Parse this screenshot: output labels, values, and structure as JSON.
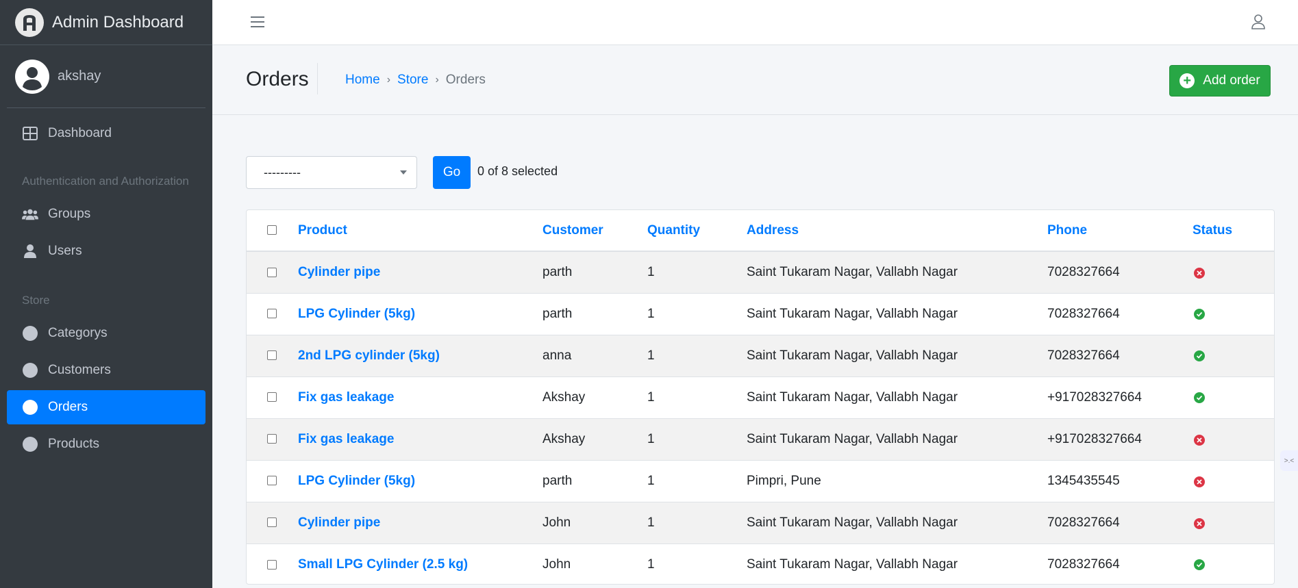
{
  "brand": {
    "title": "Admin Dashboard"
  },
  "user": {
    "name": "akshay"
  },
  "sidebar": {
    "dashboard": "Dashboard",
    "auth_header": "Authentication and Authorization",
    "groups": "Groups",
    "users": "Users",
    "store_header": "Store",
    "categorys": "Categorys",
    "customers": "Customers",
    "orders": "Orders",
    "products": "Products"
  },
  "header": {
    "title": "Orders",
    "breadcrumb": {
      "home": "Home",
      "store": "Store",
      "current": "Orders"
    },
    "add_label": "Add order"
  },
  "actions": {
    "selected_option": "---------",
    "go_label": "Go",
    "selected_count": "0 of 8 selected"
  },
  "table": {
    "columns": {
      "product": "Product",
      "customer": "Customer",
      "quantity": "Quantity",
      "address": "Address",
      "phone": "Phone",
      "status": "Status"
    },
    "rows": [
      {
        "product": "Cylinder pipe",
        "customer": "parth",
        "quantity": "1",
        "address": "Saint Tukaram Nagar, Vallabh Nagar",
        "phone": "7028327664",
        "status": false
      },
      {
        "product": "LPG Cylinder (5kg)",
        "customer": "parth",
        "quantity": "1",
        "address": "Saint Tukaram Nagar, Vallabh Nagar",
        "phone": "7028327664",
        "status": true
      },
      {
        "product": "2nd LPG cylinder (5kg)",
        "customer": "anna",
        "quantity": "1",
        "address": "Saint Tukaram Nagar, Vallabh Nagar",
        "phone": "7028327664",
        "status": true
      },
      {
        "product": "Fix gas leakage",
        "customer": "Akshay",
        "quantity": "1",
        "address": "Saint Tukaram Nagar, Vallabh Nagar",
        "phone": "+917028327664",
        "status": true
      },
      {
        "product": "Fix gas leakage",
        "customer": "Akshay",
        "quantity": "1",
        "address": "Saint Tukaram Nagar, Vallabh Nagar",
        "phone": "+917028327664",
        "status": false
      },
      {
        "product": "LPG Cylinder (5kg)",
        "customer": "parth",
        "quantity": "1",
        "address": "Pimpri, Pune",
        "phone": "1345435545",
        "status": false
      },
      {
        "product": "Cylinder pipe",
        "customer": "John",
        "quantity": "1",
        "address": "Saint Tukaram Nagar, Vallabh Nagar",
        "phone": "7028327664",
        "status": false
      },
      {
        "product": "Small LPG Cylinder (2.5 kg)",
        "customer": "John",
        "quantity": "1",
        "address": "Saint Tukaram Nagar, Vallabh Nagar",
        "phone": "7028327664",
        "status": true
      }
    ]
  },
  "colors": {
    "accent": "#007bff",
    "success": "#28a745",
    "danger": "#dc3545",
    "sidebar": "#343a40"
  }
}
